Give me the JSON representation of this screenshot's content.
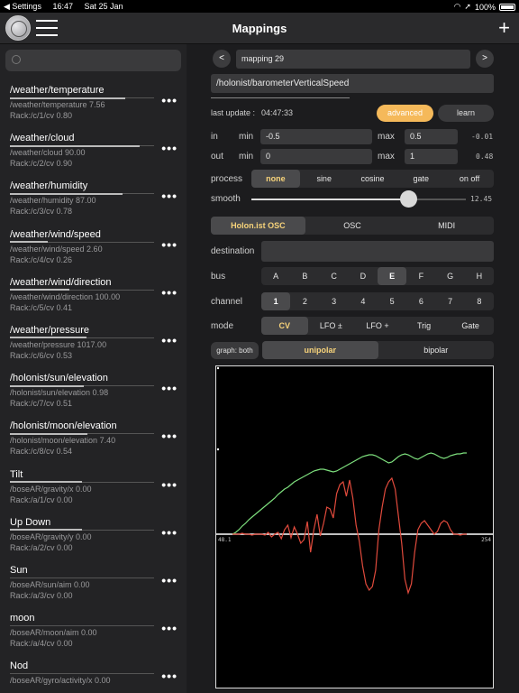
{
  "status": {
    "settings": "◀ Settings",
    "time": "16:47",
    "date": "Sat 25 Jan",
    "battery": "100%"
  },
  "nav": {
    "title": "Mappings"
  },
  "sidebar": {
    "items": [
      {
        "title": "/weather/temperature",
        "source": "/weather/temperature 7.56",
        "rack": "Rack:/c/1/cv 0.80",
        "level": 0.8
      },
      {
        "title": "/weather/cloud",
        "source": "/weather/cloud 90.00",
        "rack": "Rack:/c/2/cv 0.90",
        "level": 0.9
      },
      {
        "title": "/weather/humidity",
        "source": "/weather/humidity 87.00",
        "rack": "Rack:/c/3/cv 0.78",
        "level": 0.78
      },
      {
        "title": "/weather/wind/speed",
        "source": "/weather/wind/speed 2.60",
        "rack": "Rack:/c/4/cv 0.26",
        "level": 0.26
      },
      {
        "title": "/weather/wind/direction",
        "source": "/weather/wind/direction 100.00",
        "rack": "Rack:/c/5/cv 0.41",
        "level": 0.41
      },
      {
        "title": "/weather/pressure",
        "source": "/weather/pressure 1017.00",
        "rack": "Rack:/c/6/cv 0.53",
        "level": 0.53
      },
      {
        "title": "/holonist/sun/elevation",
        "source": "/holonist/sun/elevation 0.98",
        "rack": "Rack:/c/7/cv 0.51",
        "level": 0.51
      },
      {
        "title": "/holonist/moon/elevation",
        "source": "/holonist/moon/elevation 7.40",
        "rack": "Rack:/c/8/cv 0.54",
        "level": 0.54
      },
      {
        "title": "Tilt",
        "source": "/boseAR/gravity/x 0.00",
        "rack": "Rack:/a/1/cv 0.00",
        "level": 0.5
      },
      {
        "title": "Up Down",
        "source": "/boseAR/gravity/y 0.00",
        "rack": "Rack:/a/2/cv 0.00",
        "level": 0.5
      },
      {
        "title": "Sun",
        "source": "/boseAR/sun/aim 0.00",
        "rack": "Rack:/a/3/cv 0.00",
        "level": 0.0
      },
      {
        "title": "moon",
        "source": "/boseAR/moon/aim 0.00",
        "rack": "Rack:/a/4/cv 0.00",
        "level": 0.0
      },
      {
        "title": "Nod",
        "source": "/boseAR/gyro/activity/x 0.00",
        "rack": "",
        "level": 0.0
      }
    ]
  },
  "mapping": {
    "prev": "<",
    "next": ">",
    "name": "mapping 29",
    "address": "/holonist/barometerVerticalSpeed",
    "last_update_label": "last update :",
    "last_update": "04:47:33",
    "advanced": "advanced",
    "learn": "learn",
    "in_label": "in",
    "out_label": "out",
    "min_label": "min",
    "max_label": "max",
    "in_min": "-0.5",
    "in_max": "0.5",
    "in_value": "-0.01",
    "out_min": "0",
    "out_max": "1",
    "out_value": "0.48",
    "process_label": "process",
    "process_options": [
      "none",
      "sine",
      "cosine",
      "gate",
      "on off"
    ],
    "process_selected": 0,
    "smooth_label": "smooth",
    "smooth_value": "12.45",
    "smooth_level": 0.73,
    "protocols": [
      "Holon.ist OSC",
      "OSC",
      "MIDI"
    ],
    "protocol_selected": 0,
    "destination_label": "destination",
    "destination": "",
    "bus_label": "bus",
    "bus_options": [
      "A",
      "B",
      "C",
      "D",
      "E",
      "F",
      "G",
      "H"
    ],
    "bus_selected": 4,
    "channel_label": "channel",
    "channel_options": [
      "1",
      "2",
      "3",
      "4",
      "5",
      "6",
      "7",
      "8"
    ],
    "channel_selected": 0,
    "mode_label": "mode",
    "mode_options": [
      "CV",
      "LFO ±",
      "LFO +",
      "Trig",
      "Gate"
    ],
    "mode_selected": 0,
    "graph_label": "graph: both",
    "polarity_options": [
      "unipolar",
      "bipolar"
    ],
    "polarity_selected": 0
  },
  "chart_data": {
    "type": "line",
    "x_start_label": "48.1",
    "x_end_label": "254",
    "series": [
      {
        "color": "#7ee07e",
        "values": [
          0.0,
          0.02,
          0.05,
          0.09,
          0.12,
          0.16,
          0.19,
          0.22,
          0.25,
          0.28,
          0.31,
          0.34,
          0.37,
          0.4,
          0.44,
          0.47,
          0.5,
          0.52,
          0.55,
          0.58,
          0.6,
          0.62,
          0.64,
          0.66,
          0.68,
          0.7,
          0.71,
          0.72,
          0.72,
          0.71,
          0.7,
          0.69,
          0.7,
          0.72,
          0.74,
          0.76,
          0.78,
          0.8,
          0.82,
          0.84,
          0.86,
          0.87,
          0.88,
          0.88,
          0.87,
          0.85,
          0.83,
          0.81,
          0.79,
          0.8,
          0.83,
          0.86,
          0.88,
          0.89,
          0.88,
          0.86,
          0.84,
          0.83,
          0.85,
          0.87,
          0.89,
          0.9,
          0.89,
          0.87,
          0.85,
          0.84,
          0.85,
          0.87,
          0.88,
          0.89,
          0.89,
          0.9,
          0.9
        ]
      },
      {
        "color": "#e04a3c",
        "values": [
          0.0,
          0.0,
          0.0,
          0.01,
          0.0,
          0.0,
          -0.01,
          0.0,
          0.0,
          0.0,
          -0.01,
          0.02,
          -0.03,
          0.0,
          0.02,
          -0.05,
          0.05,
          0.1,
          -0.04,
          0.08,
          0.0,
          -0.1,
          -0.06,
          0.14,
          -0.2,
          0.05,
          0.22,
          -0.02,
          0.12,
          0.3,
          0.28,
          0.18,
          0.45,
          0.55,
          0.58,
          0.42,
          0.6,
          0.4,
          0.1,
          -0.08,
          -0.35,
          -0.55,
          -0.62,
          -0.58,
          -0.4,
          0.05,
          0.3,
          0.5,
          0.58,
          0.62,
          0.5,
          0.2,
          -0.1,
          -0.5,
          -0.65,
          -0.55,
          -0.2,
          0.05,
          0.12,
          0.15,
          0.1,
          0.05,
          0.0,
          0.03,
          0.12,
          0.15,
          0.13,
          0.05,
          0.0,
          0.0,
          -0.01,
          0.0,
          0.0
        ]
      }
    ]
  }
}
